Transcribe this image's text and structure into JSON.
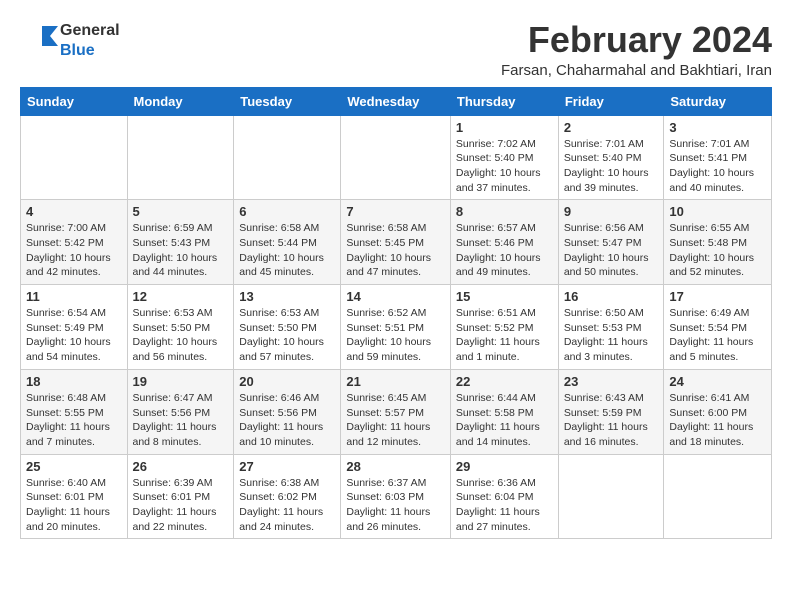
{
  "logo": {
    "general": "General",
    "blue": "Blue"
  },
  "header": {
    "month_year": "February 2024",
    "location": "Farsan, Chaharmahal and Bakhtiari, Iran"
  },
  "weekdays": [
    "Sunday",
    "Monday",
    "Tuesday",
    "Wednesday",
    "Thursday",
    "Friday",
    "Saturday"
  ],
  "weeks": [
    [
      {
        "day": "",
        "sunrise": "",
        "sunset": "",
        "daylight": ""
      },
      {
        "day": "",
        "sunrise": "",
        "sunset": "",
        "daylight": ""
      },
      {
        "day": "",
        "sunrise": "",
        "sunset": "",
        "daylight": ""
      },
      {
        "day": "",
        "sunrise": "",
        "sunset": "",
        "daylight": ""
      },
      {
        "day": "1",
        "sunrise": "Sunrise: 7:02 AM",
        "sunset": "Sunset: 5:40 PM",
        "daylight": "Daylight: 10 hours and 37 minutes."
      },
      {
        "day": "2",
        "sunrise": "Sunrise: 7:01 AM",
        "sunset": "Sunset: 5:40 PM",
        "daylight": "Daylight: 10 hours and 39 minutes."
      },
      {
        "day": "3",
        "sunrise": "Sunrise: 7:01 AM",
        "sunset": "Sunset: 5:41 PM",
        "daylight": "Daylight: 10 hours and 40 minutes."
      }
    ],
    [
      {
        "day": "4",
        "sunrise": "Sunrise: 7:00 AM",
        "sunset": "Sunset: 5:42 PM",
        "daylight": "Daylight: 10 hours and 42 minutes."
      },
      {
        "day": "5",
        "sunrise": "Sunrise: 6:59 AM",
        "sunset": "Sunset: 5:43 PM",
        "daylight": "Daylight: 10 hours and 44 minutes."
      },
      {
        "day": "6",
        "sunrise": "Sunrise: 6:58 AM",
        "sunset": "Sunset: 5:44 PM",
        "daylight": "Daylight: 10 hours and 45 minutes."
      },
      {
        "day": "7",
        "sunrise": "Sunrise: 6:58 AM",
        "sunset": "Sunset: 5:45 PM",
        "daylight": "Daylight: 10 hours and 47 minutes."
      },
      {
        "day": "8",
        "sunrise": "Sunrise: 6:57 AM",
        "sunset": "Sunset: 5:46 PM",
        "daylight": "Daylight: 10 hours and 49 minutes."
      },
      {
        "day": "9",
        "sunrise": "Sunrise: 6:56 AM",
        "sunset": "Sunset: 5:47 PM",
        "daylight": "Daylight: 10 hours and 50 minutes."
      },
      {
        "day": "10",
        "sunrise": "Sunrise: 6:55 AM",
        "sunset": "Sunset: 5:48 PM",
        "daylight": "Daylight: 10 hours and 52 minutes."
      }
    ],
    [
      {
        "day": "11",
        "sunrise": "Sunrise: 6:54 AM",
        "sunset": "Sunset: 5:49 PM",
        "daylight": "Daylight: 10 hours and 54 minutes."
      },
      {
        "day": "12",
        "sunrise": "Sunrise: 6:53 AM",
        "sunset": "Sunset: 5:50 PM",
        "daylight": "Daylight: 10 hours and 56 minutes."
      },
      {
        "day": "13",
        "sunrise": "Sunrise: 6:53 AM",
        "sunset": "Sunset: 5:50 PM",
        "daylight": "Daylight: 10 hours and 57 minutes."
      },
      {
        "day": "14",
        "sunrise": "Sunrise: 6:52 AM",
        "sunset": "Sunset: 5:51 PM",
        "daylight": "Daylight: 10 hours and 59 minutes."
      },
      {
        "day": "15",
        "sunrise": "Sunrise: 6:51 AM",
        "sunset": "Sunset: 5:52 PM",
        "daylight": "Daylight: 11 hours and 1 minute."
      },
      {
        "day": "16",
        "sunrise": "Sunrise: 6:50 AM",
        "sunset": "Sunset: 5:53 PM",
        "daylight": "Daylight: 11 hours and 3 minutes."
      },
      {
        "day": "17",
        "sunrise": "Sunrise: 6:49 AM",
        "sunset": "Sunset: 5:54 PM",
        "daylight": "Daylight: 11 hours and 5 minutes."
      }
    ],
    [
      {
        "day": "18",
        "sunrise": "Sunrise: 6:48 AM",
        "sunset": "Sunset: 5:55 PM",
        "daylight": "Daylight: 11 hours and 7 minutes."
      },
      {
        "day": "19",
        "sunrise": "Sunrise: 6:47 AM",
        "sunset": "Sunset: 5:56 PM",
        "daylight": "Daylight: 11 hours and 8 minutes."
      },
      {
        "day": "20",
        "sunrise": "Sunrise: 6:46 AM",
        "sunset": "Sunset: 5:56 PM",
        "daylight": "Daylight: 11 hours and 10 minutes."
      },
      {
        "day": "21",
        "sunrise": "Sunrise: 6:45 AM",
        "sunset": "Sunset: 5:57 PM",
        "daylight": "Daylight: 11 hours and 12 minutes."
      },
      {
        "day": "22",
        "sunrise": "Sunrise: 6:44 AM",
        "sunset": "Sunset: 5:58 PM",
        "daylight": "Daylight: 11 hours and 14 minutes."
      },
      {
        "day": "23",
        "sunrise": "Sunrise: 6:43 AM",
        "sunset": "Sunset: 5:59 PM",
        "daylight": "Daylight: 11 hours and 16 minutes."
      },
      {
        "day": "24",
        "sunrise": "Sunrise: 6:41 AM",
        "sunset": "Sunset: 6:00 PM",
        "daylight": "Daylight: 11 hours and 18 minutes."
      }
    ],
    [
      {
        "day": "25",
        "sunrise": "Sunrise: 6:40 AM",
        "sunset": "Sunset: 6:01 PM",
        "daylight": "Daylight: 11 hours and 20 minutes."
      },
      {
        "day": "26",
        "sunrise": "Sunrise: 6:39 AM",
        "sunset": "Sunset: 6:01 PM",
        "daylight": "Daylight: 11 hours and 22 minutes."
      },
      {
        "day": "27",
        "sunrise": "Sunrise: 6:38 AM",
        "sunset": "Sunset: 6:02 PM",
        "daylight": "Daylight: 11 hours and 24 minutes."
      },
      {
        "day": "28",
        "sunrise": "Sunrise: 6:37 AM",
        "sunset": "Sunset: 6:03 PM",
        "daylight": "Daylight: 11 hours and 26 minutes."
      },
      {
        "day": "29",
        "sunrise": "Sunrise: 6:36 AM",
        "sunset": "Sunset: 6:04 PM",
        "daylight": "Daylight: 11 hours and 27 minutes."
      },
      {
        "day": "",
        "sunrise": "",
        "sunset": "",
        "daylight": ""
      },
      {
        "day": "",
        "sunrise": "",
        "sunset": "",
        "daylight": ""
      }
    ]
  ]
}
